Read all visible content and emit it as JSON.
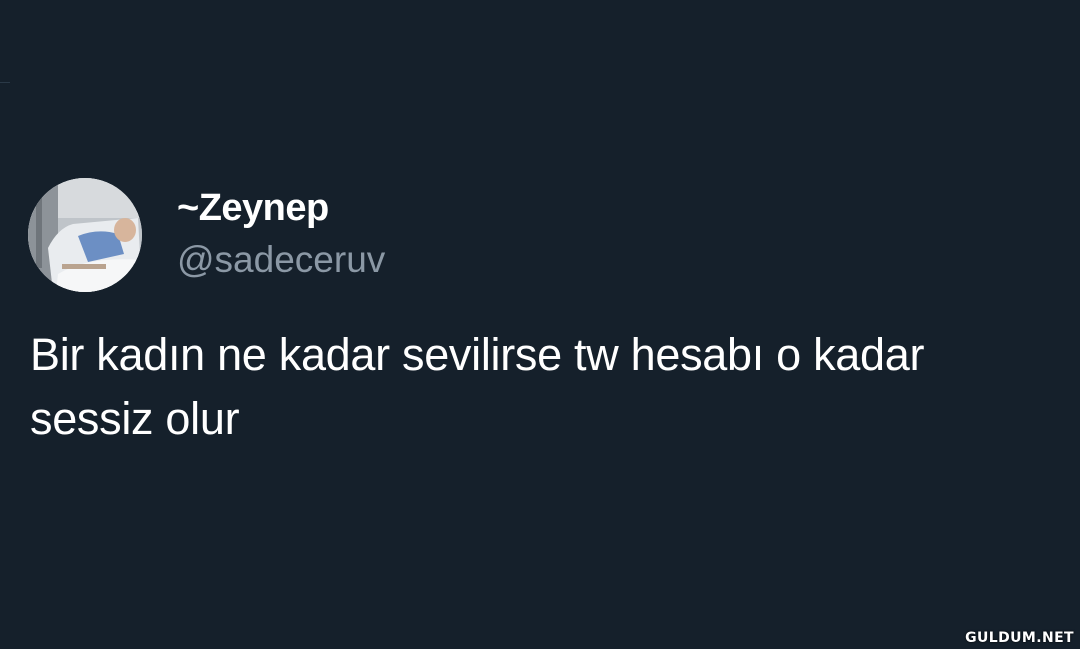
{
  "tweet": {
    "display_name": "~Zeynep",
    "handle": "@sadeceruv",
    "text": "Bir kadın ne kadar sevilirse tw hesabı o kadar sessiz olur"
  },
  "watermark": "GULDUM.NET",
  "avatar": {
    "icon": "profile-photo"
  },
  "colors": {
    "background": "#15202b",
    "name": "#ffffff",
    "handle": "#8b98a5",
    "text": "#ffffff"
  }
}
